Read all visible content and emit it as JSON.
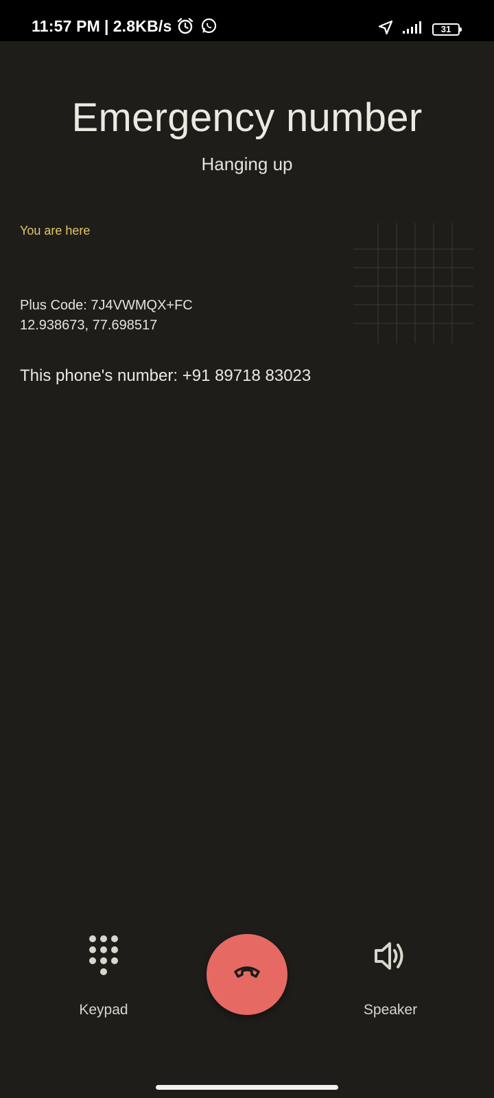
{
  "status_bar": {
    "time": "11:57 PM",
    "separator": "|",
    "network_speed": "2.8KB/s",
    "left_icons": [
      "alarm-icon",
      "whatsapp-icon"
    ],
    "right_icons": [
      "location-arrow-icon",
      "signal-icon",
      "battery-icon"
    ],
    "battery_level": "31"
  },
  "call": {
    "title": "Emergency number",
    "status": "Hanging up"
  },
  "location": {
    "label": "You are here",
    "plus_code": "Plus Code: 7J4VWMQX+FC",
    "coordinates": "12.938673, 77.698517",
    "phone_number": "This phone's number: +91 89718 83023"
  },
  "actions": {
    "keypad_label": "Keypad",
    "speaker_label": "Speaker",
    "end_call_icon": "end-call-icon"
  },
  "colors": {
    "background": "#1e1d1a",
    "accent_label": "#e2c76a",
    "end_call": "#e66a63"
  }
}
